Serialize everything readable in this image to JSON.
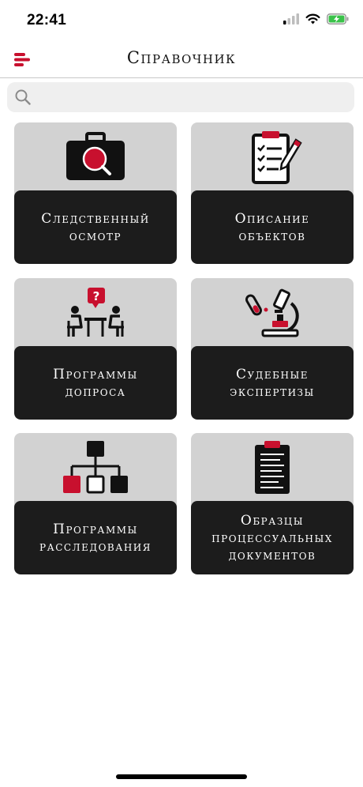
{
  "status_bar": {
    "time": "22:41"
  },
  "header": {
    "title": "Справочник"
  },
  "search": {
    "placeholder": "",
    "value": ""
  },
  "tiles": [
    {
      "label": "Следственный\nосмотр",
      "icon": "evidence-case-icon"
    },
    {
      "label": "Описание\nобъектов",
      "icon": "clipboard-checklist-icon"
    },
    {
      "label": "Программы\nдопроса",
      "icon": "interrogation-icon"
    },
    {
      "label": "Судебные\nэкспертизы",
      "icon": "microscope-icon"
    },
    {
      "label": "Программы\nрасследования",
      "icon": "hierarchy-icon"
    },
    {
      "label": "Образцы\nпроцессуальных\nдокументов",
      "icon": "document-clipboard-icon"
    }
  ],
  "colors": {
    "accent": "#c8102e",
    "tile_bg": "#d2d2d2",
    "label_bg": "#1c1c1c"
  }
}
